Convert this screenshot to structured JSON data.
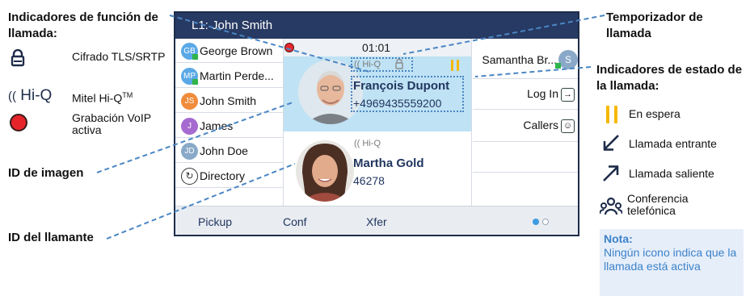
{
  "callouts": {
    "call_feature_indicators": "Indicadores de función de llamada:",
    "image_id": "ID de imagen",
    "caller_id": "ID del llamante",
    "call_timer": "Temporizador de llamada",
    "call_state_indicators": "Indicadores de estado de la llamada:"
  },
  "features": [
    {
      "icon": "lock-icon",
      "label": "Cifrado TLS/SRTP"
    },
    {
      "icon": "hiq-icon",
      "icon_text": "Hi-Q",
      "label": "Mitel Hi-Q",
      "label_sup": "TM"
    },
    {
      "icon": "record-icon",
      "label": "Grabación VoIP activa"
    }
  ],
  "states": [
    {
      "icon": "hold-icon",
      "label": "En espera"
    },
    {
      "icon": "incoming-call-icon",
      "label": "Llamada entrante"
    },
    {
      "icon": "outgoing-call-icon",
      "label": "Llamada saliente"
    },
    {
      "icon": "conference-icon",
      "label": "Conferencia telefónica"
    }
  ],
  "note": {
    "title": "Nota:",
    "body": "Ningún icono indica que la llamada está activa"
  },
  "phone": {
    "title": "L1: John Smith",
    "timer": "01:01",
    "lines": [
      {
        "initials": "GB",
        "name": "George Brown",
        "color": "#5aa9e6"
      },
      {
        "initials": "MP",
        "name": "Martin Perde...",
        "color": "#5aa9e6"
      },
      {
        "initials": "JS",
        "name": "John Smith",
        "color": "#f08c3a"
      },
      {
        "initials": "J",
        "name": "James",
        "color": "#a56bd0"
      },
      {
        "initials": "JD",
        "name": "John Doe",
        "color": "#8aa9c8"
      },
      {
        "initials": "",
        "name": "Directory",
        "color": ""
      }
    ],
    "call1": {
      "quality": "Hi-Q",
      "name": "François Dupont",
      "number": "+4969435559200"
    },
    "call2": {
      "quality": "Hi-Q",
      "name": "Martha Gold",
      "number": "46278"
    },
    "right": {
      "contact_name": "Samantha Br...",
      "contact_initial": "S",
      "login": "Log In",
      "callers": "Callers"
    },
    "softkeys": [
      "Pickup",
      "Conf",
      "Xfer"
    ]
  },
  "colors": {
    "accent": "#273a63",
    "hold": "#f6b800",
    "record": "#e8242b",
    "note_text": "#3d82c9"
  }
}
